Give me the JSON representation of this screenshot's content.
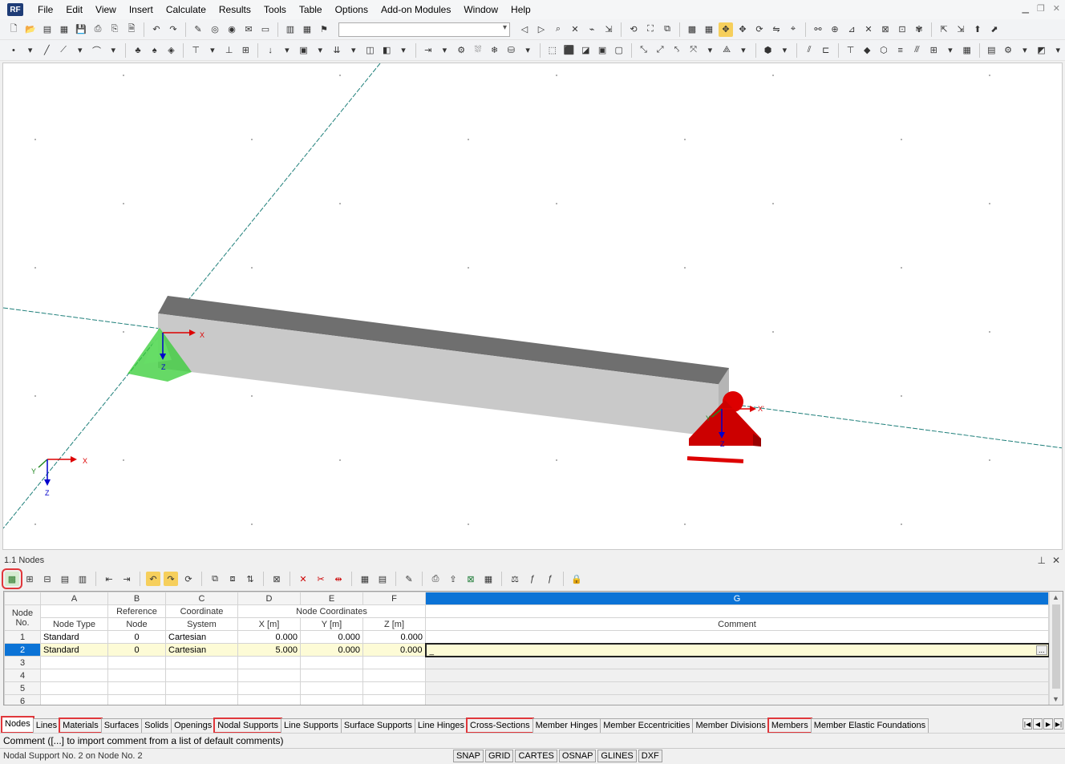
{
  "menu": {
    "app_icon_label": "RF",
    "items": [
      "File",
      "Edit",
      "View",
      "Insert",
      "Calculate",
      "Results",
      "Tools",
      "Table",
      "Options",
      "Add-on Modules",
      "Window",
      "Help"
    ]
  },
  "viewport": {
    "node1_axes": {
      "x": "X",
      "z": "Z"
    },
    "node2_axes": {
      "x": "X'",
      "y": "Y'",
      "z": "Z"
    },
    "global_axes": {
      "x": "X",
      "y": "Y",
      "z": "Z"
    }
  },
  "panel": {
    "title": "1.1 Nodes",
    "pin_icon": "pin-icon",
    "close_icon": "close-icon"
  },
  "table": {
    "column_letters": [
      "A",
      "B",
      "C",
      "D",
      "E",
      "F",
      "G"
    ],
    "header": {
      "node_no": [
        "Node",
        "No."
      ],
      "node_type": "Node Type",
      "reference_node": [
        "Reference",
        "Node"
      ],
      "coordinate_system": [
        "Coordinate",
        "System"
      ],
      "node_coordinates": "Node Coordinates",
      "x": "X [m]",
      "y": "Y [m]",
      "z": "Z [m]",
      "comment": "Comment"
    },
    "rows": [
      {
        "no": "1",
        "type": "Standard",
        "ref": "0",
        "system": "Cartesian",
        "x": "0.000",
        "y": "0.000",
        "z": "0.000",
        "comment": ""
      },
      {
        "no": "2",
        "type": "Standard",
        "ref": "0",
        "system": "Cartesian",
        "x": "5.000",
        "y": "0.000",
        "z": "0.000",
        "comment": ""
      },
      {
        "no": "3",
        "type": "",
        "ref": "",
        "system": "",
        "x": "",
        "y": "",
        "z": "",
        "comment": ""
      },
      {
        "no": "4",
        "type": "",
        "ref": "",
        "system": "",
        "x": "",
        "y": "",
        "z": "",
        "comment": ""
      },
      {
        "no": "5",
        "type": "",
        "ref": "",
        "system": "",
        "x": "",
        "y": "",
        "z": "",
        "comment": ""
      },
      {
        "no": "6",
        "type": "",
        "ref": "",
        "system": "",
        "x": "",
        "y": "",
        "z": "",
        "comment": ""
      }
    ],
    "active_row": 2,
    "ellipsis": "..."
  },
  "tabs": [
    {
      "label": "Nodes",
      "active": true,
      "highlight": true
    },
    {
      "label": "Lines",
      "active": false,
      "highlight": false
    },
    {
      "label": "Materials",
      "active": false,
      "highlight": true
    },
    {
      "label": "Surfaces",
      "active": false,
      "highlight": false
    },
    {
      "label": "Solids",
      "active": false,
      "highlight": false
    },
    {
      "label": "Openings",
      "active": false,
      "highlight": false
    },
    {
      "label": "Nodal Supports",
      "active": false,
      "highlight": true
    },
    {
      "label": "Line Supports",
      "active": false,
      "highlight": false
    },
    {
      "label": "Surface Supports",
      "active": false,
      "highlight": false
    },
    {
      "label": "Line Hinges",
      "active": false,
      "highlight": false
    },
    {
      "label": "Cross-Sections",
      "active": false,
      "highlight": true
    },
    {
      "label": "Member Hinges",
      "active": false,
      "highlight": false
    },
    {
      "label": "Member Eccentricities",
      "active": false,
      "highlight": false
    },
    {
      "label": "Member Divisions",
      "active": false,
      "highlight": false
    },
    {
      "label": "Members",
      "active": false,
      "highlight": true
    },
    {
      "label": "Member Elastic Foundations",
      "active": false,
      "highlight": false
    }
  ],
  "hint": "Comment ([...] to import comment from a list of default comments)",
  "status": {
    "text": "Nodal Support No. 2 on Node No. 2",
    "toggles": [
      "SNAP",
      "GRID",
      "CARTES",
      "OSNAP",
      "GLINES",
      "DXF"
    ]
  },
  "colors": {
    "accent": "#0b73d6",
    "highlight": "#e0373b",
    "support_fixed": "#33cc33",
    "support_hinged": "#dd0000",
    "beam_front": "#c9c9c9",
    "beam_top": "#6f6f6f"
  }
}
